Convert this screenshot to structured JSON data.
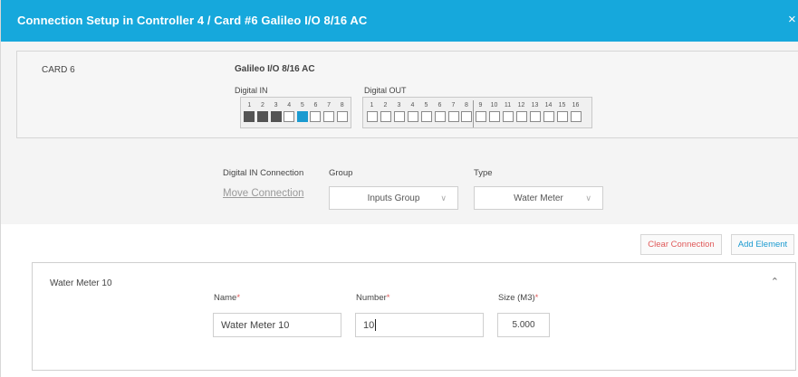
{
  "dialog": {
    "title": "Connection Setup in Controller 4 / Card #6 Galileo I/O 8/16 AC",
    "close_label": "×",
    "header_color": "#16a8dc"
  },
  "card": {
    "label": "CARD 6",
    "name": "Galileo I/O 8/16 AC",
    "digital_in_label": "Digital IN",
    "digital_out_label": "Digital OUT",
    "digital_in": [
      {
        "num": "1",
        "state": "dark"
      },
      {
        "num": "2",
        "state": "dark"
      },
      {
        "num": "3",
        "state": "dark"
      },
      {
        "num": "4",
        "state": "empty"
      },
      {
        "num": "5",
        "state": "blue"
      },
      {
        "num": "6",
        "state": "empty"
      },
      {
        "num": "7",
        "state": "empty"
      },
      {
        "num": "8",
        "state": "empty"
      }
    ],
    "digital_out": [
      {
        "num": "1",
        "state": "empty"
      },
      {
        "num": "2",
        "state": "empty"
      },
      {
        "num": "3",
        "state": "empty"
      },
      {
        "num": "4",
        "state": "empty"
      },
      {
        "num": "5",
        "state": "empty"
      },
      {
        "num": "6",
        "state": "empty"
      },
      {
        "num": "7",
        "state": "empty"
      },
      {
        "num": "8",
        "state": "empty"
      },
      {
        "num": "9",
        "state": "empty"
      },
      {
        "num": "10",
        "state": "empty"
      },
      {
        "num": "11",
        "state": "empty"
      },
      {
        "num": "12",
        "state": "empty"
      },
      {
        "num": "13",
        "state": "empty"
      },
      {
        "num": "14",
        "state": "empty"
      },
      {
        "num": "15",
        "state": "empty"
      },
      {
        "num": "16",
        "state": "empty"
      }
    ]
  },
  "connection": {
    "digital_in_label": "Digital IN Connection",
    "move_link": "Move Connection",
    "group_label": "Group",
    "group_value": "Inputs Group",
    "type_label": "Type",
    "type_value": "Water Meter"
  },
  "actions": {
    "clear_label": "Clear Connection",
    "add_label": "Add Element"
  },
  "element": {
    "title": "Water Meter 10",
    "name_label": "Name",
    "name_value": "Water Meter 10",
    "number_label": "Number",
    "number_value": "10",
    "size_label": "Size (M3)",
    "size_value": "5.000",
    "required_mark": "*"
  }
}
